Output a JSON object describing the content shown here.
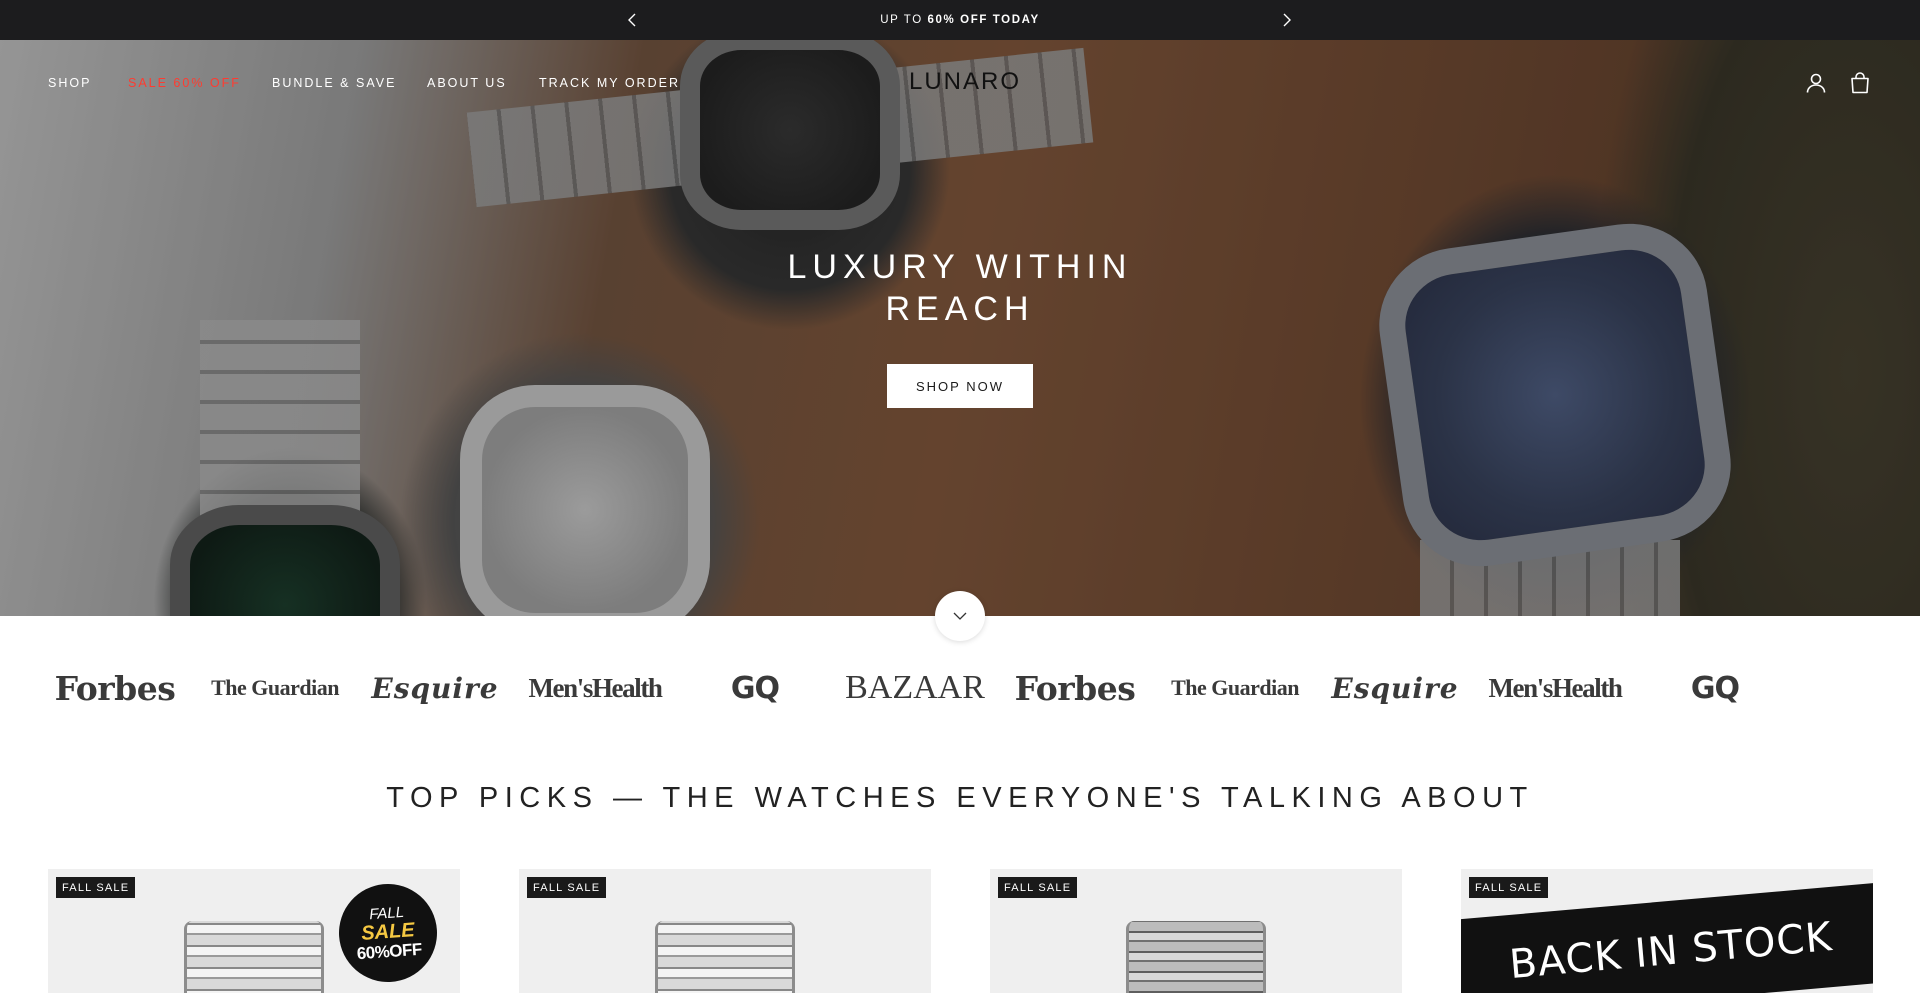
{
  "announcement": {
    "prefix": "UP TO ",
    "highlight": "60% OFF TODAY"
  },
  "nav": {
    "links": [
      "SHOP",
      "SALE 60% OFF",
      "BUNDLE & SAVE",
      "ABOUT US",
      "TRACK MY ORDER"
    ],
    "logo": "LUNARO",
    "sale_color": "#ff3b30"
  },
  "hero": {
    "title_line1": "LUXURY WITHIN",
    "title_line2": "REACH",
    "cta": "SHOP NOW"
  },
  "press_logos": [
    "Forbes",
    "The Guardian",
    "Esquire",
    "Men'sHealth",
    "GQ",
    "BAZAAR",
    "Forbes",
    "The Guardian",
    "Esquire",
    "Men'sHealth",
    "GQ"
  ],
  "section": {
    "title": "TOP PICKS — THE WATCHES EVERYONE'S TALKING ABOUT"
  },
  "products": [
    {
      "badge": "FALL SALE",
      "overlay": {
        "line1": "FALL",
        "line2": "SALE",
        "line3": "60%OFF"
      }
    },
    {
      "badge": "FALL SALE"
    },
    {
      "badge": "FALL SALE"
    },
    {
      "badge": "FALL SALE",
      "overlay_text": "BACK IN STOCK"
    }
  ],
  "colors": {
    "announcement_bg": "#1c1c1e",
    "sale_red": "#ff3b30",
    "badge_bg": "#1a1a1a",
    "card_bg": "#efefef"
  }
}
